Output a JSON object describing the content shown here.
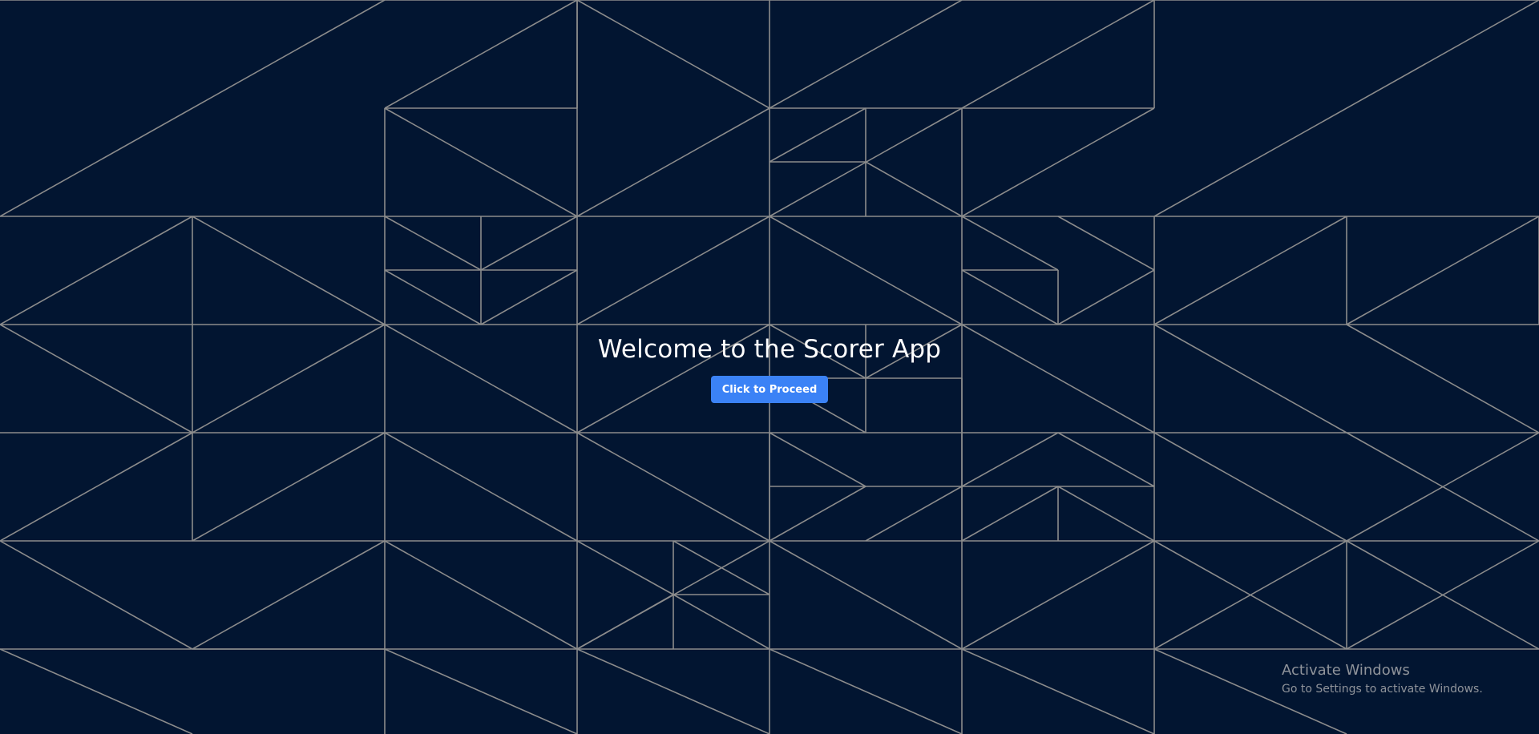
{
  "page": {
    "background_color": "#021531",
    "pattern_line_color": "#8c8c8c",
    "accent_color": "#3b82f6"
  },
  "welcome": {
    "title": "Welcome to the Scorer App",
    "button_label": "Click to Proceed"
  },
  "watermark": {
    "title": "Activate Windows",
    "subtitle": "Go to Settings to activate Windows."
  }
}
